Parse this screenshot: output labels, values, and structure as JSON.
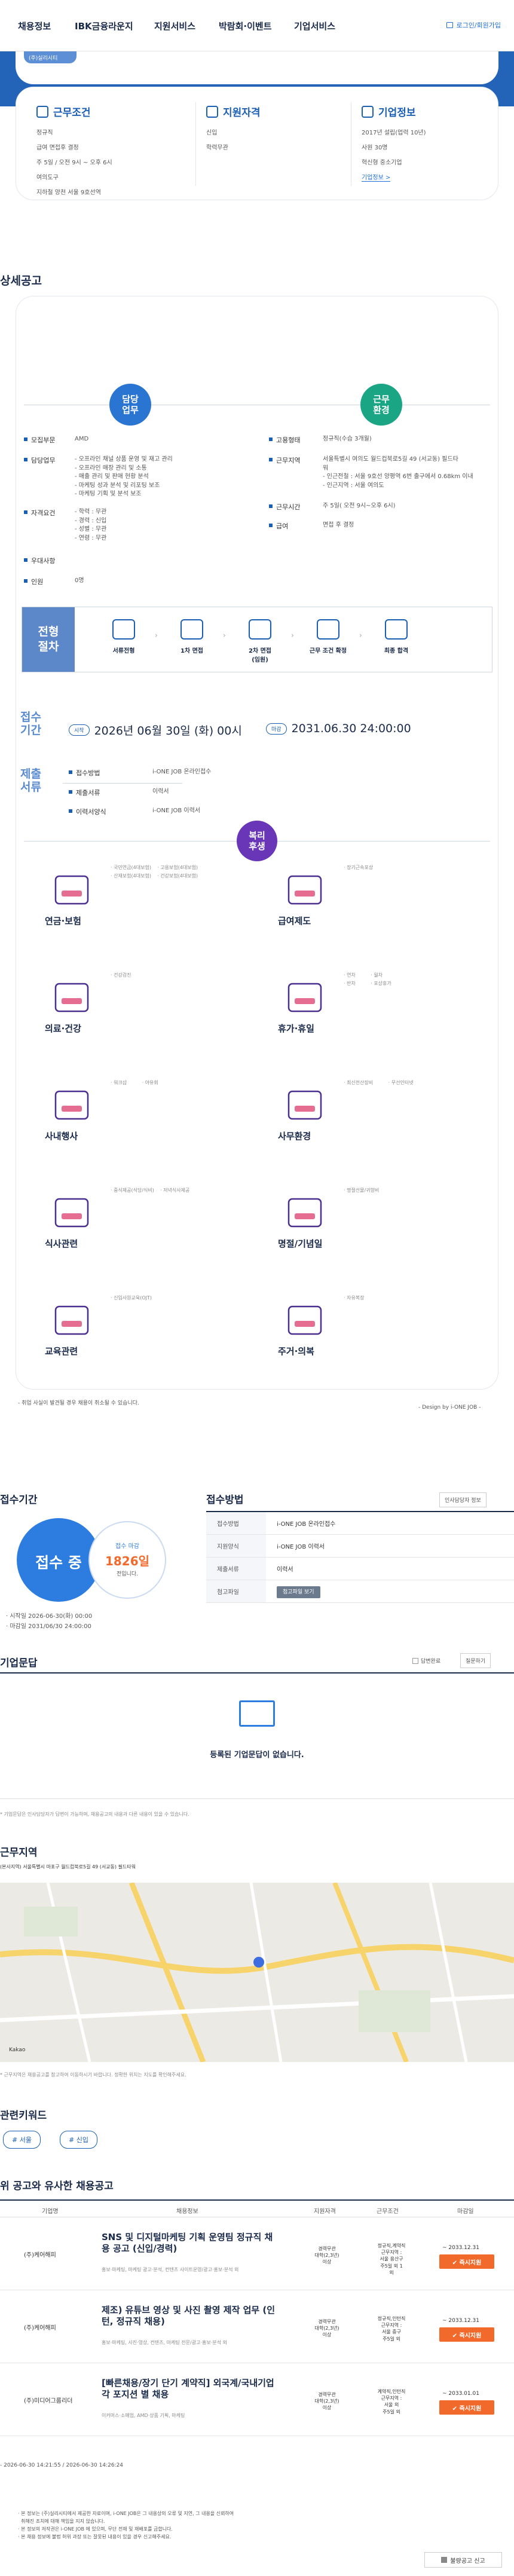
{
  "nav": {
    "items": [
      "채용정보",
      "IBK금융라운지",
      "지원서비스",
      "박람회·이벤트",
      "기업서비스"
    ],
    "login": "로그인/회원가입"
  },
  "band": {
    "tag": "(주)실리시티"
  },
  "summary": {
    "cols": [
      {
        "title": "근무조건",
        "lines": [
          "정규직",
          "급여 면접후 결정",
          "주 5일 / 오전 9시 ~ 오후 6시",
          "여의도구",
          "지하철 양천 서울 9호선역"
        ]
      },
      {
        "title": "지원자격",
        "lines": [
          "신입",
          "학력무관"
        ]
      },
      {
        "title": "기업정보",
        "lines": [
          "2017년 설립(업력 10년)",
          "사원 30명",
          "혁신형 중소기업"
        ],
        "link": "기업정보 >"
      }
    ]
  },
  "detail": {
    "title": "상세공고",
    "duty_circle": "담당\n업무",
    "env_circle": "근무\n환경",
    "left": [
      {
        "k": "모집부문",
        "v": "AMD"
      },
      {
        "k": "담당업무",
        "v": "- 오프라인 채널 상품 운영 및 재고 관리\n- 오프라인 매장 관리 및 소통\n- 매출 관리 및 판매 현황 분석\n- 마케팅 성과 분석 및 리포팅 보조\n- 마케팅 기획 및 분석 보조"
      },
      {
        "k": "자격요건",
        "v": "- 학력 : 무관\n- 경력 : 신입\n- 성별 : 무관\n- 연령 : 무관"
      },
      {
        "k": "우대사항",
        "v": ""
      },
      {
        "k": "인원",
        "v": "0명"
      }
    ],
    "right": [
      {
        "k": "고용형태",
        "v": "정규직(수습 3개월)"
      },
      {
        "k": "근무지역",
        "v": "서울특별시 여의도 월드컵북로5길 49 (서교동) 필드타\n워\n- 인근전철 : 서울 9호선 양평역 6번 출구에서 0.68km 이내\n- 인근지역 : 서울 여의도"
      },
      {
        "k": "근무시간",
        "v": "주 5일( 오전 9시~오후 6시)"
      },
      {
        "k": "급여",
        "v": "면접 후 결정"
      }
    ],
    "steps_label": "전형\n절차",
    "steps": [
      "서류전형",
      "1차 면접",
      "2차 면접\n(임원)",
      "근무 조건 확정",
      "최종 합격"
    ],
    "period_label": "접수\n기간",
    "start_pill": "시작",
    "start": "2026년 06월 30일 (화) 00시",
    "end_pill": "마감",
    "end": "2031.06.30 24:00:00",
    "docs_label": "제출\n서류",
    "docs": [
      {
        "k": "접수방법",
        "v": "i-ONE JOB 온라인접수"
      },
      {
        "k": "제출서류",
        "v": "이력서"
      },
      {
        "k": "이력서양식",
        "v": "i-ONE JOB 이력서"
      }
    ],
    "welfare_circle": "복리\n후생",
    "welfare": [
      {
        "label": "연금·보험",
        "items": "· 국민연금(4대보험)    · 고용보험(4대보험)\n· 산재보험(4대보험)    · 건강보험(4대보험)",
        "icon": "glasses-icon"
      },
      {
        "label": "급여제도",
        "items": "· 장기근속포상",
        "icon": "card-icon"
      },
      {
        "label": "의료·건강",
        "items": "· 건강검진",
        "icon": "heart-icon"
      },
      {
        "label": "휴가·휴일",
        "items": "· 연차          · 월차\n· 반차          · 포상휴가",
        "icon": "calendar-icon"
      },
      {
        "label": "사내행사",
        "items": "· 워크샵          · 야유회",
        "icon": "mic-icon"
      },
      {
        "label": "사무환경",
        "items": "· 최신전산장비          · 무선인터넷",
        "icon": "monitor-icon"
      },
      {
        "label": "식사관련",
        "items": "· 중식제공(식당/식비)    · 저녁식사제공",
        "icon": "bowl-icon"
      },
      {
        "label": "명절/기념일",
        "items": "· 명절선물/귀향비",
        "icon": "gift-icon"
      },
      {
        "label": "교육관련",
        "items": "· 신입사원교육(OJT)",
        "icon": "book-icon"
      },
      {
        "label": "주거·의복",
        "items": "· 자유복장",
        "icon": "shirt-icon"
      }
    ],
    "note": "- 취업 사실이 발견될 경우 채용이 취소될 수 있습니다.",
    "design_by": "- Design by i-ONE JOB -"
  },
  "apply": {
    "period_title": "접수기간",
    "status": "접수 중",
    "dday_label": "접수 마감",
    "dday": "1826일",
    "dday_suffix": "전입니다.",
    "start": "· 시작일 2026-06-30(화) 00:00",
    "end": "· 마감일 2031/06/30 24:00:00",
    "method_title": "접수방법",
    "resume_btn": "인사담당자 정보",
    "rows": [
      {
        "k": "접수방법",
        "v": "i-ONE JOB 온라인접수"
      },
      {
        "k": "지원양식",
        "v": "i-ONE JOB 이력서"
      },
      {
        "k": "제출서류",
        "v": "이력서"
      },
      {
        "k": "첨고파일",
        "v": "첨고파일 보기"
      }
    ]
  },
  "qna": {
    "title": "기업문답",
    "check": "답변완료",
    "write_btn": "질문하기",
    "empty": "등록된 기업문답이 없습니다.",
    "note": "* 기업문답은 인사담당자가 답변이 가능하며, 채용공고의 내용과 다른 내용이 있을 수 있습니다."
  },
  "location": {
    "title": "근무지역",
    "address": "(본사지역) 서울특별시 마포구 월드컵북로5길 49 (서교동) 필드타워",
    "note": "* 근무지역은 채용공고를 참고하여 이동하시기 바랍니다. 정확한 위치는 지도를 확인해주세요.",
    "scale": "Kakao"
  },
  "keywords": {
    "title": "관련키워드",
    "items": [
      "# 서울",
      "# 신입"
    ]
  },
  "similar": {
    "title": "위 공고와 유사한 채용공고",
    "head": [
      "기업명",
      "채용정보",
      "지원자격",
      "근무조건",
      "마감일"
    ],
    "rows": [
      {
        "co": "(주)케어해피",
        "title": "SNS 및 디지털마케팅 기획 운영팀 정규직 채용 공고 (신입/경력)",
        "sub": "홍보·마케팅, 마케팅 광고·분석, 컨텐츠 사이트운영/광고·홍보·분석 외",
        "c3": "경력무관\n대학(2,3년)\n이상",
        "c4": "정규직,계약직\n근무지역 :\n서울 용산구\n주5일 외 1\n외",
        "dl": "~ 2033.12.31",
        "apply": "✔ 즉시지원"
      },
      {
        "co": "(주)케어해피",
        "title": "제조) 유튜브 영상 및 사진 촬영 제작 업무 (인턴, 정규직 채용)",
        "sub": "홍보·마케팅, 사진·영상, 컨텐츠, 마케팅 전문/광고·홍보·분석 외",
        "c3": "경력무관\n대학(2,3년)\n이상",
        "c4": "정규직,인턴직\n근무지역 :\n서울 중구\n주5일 외",
        "dl": "~ 2033.12.31",
        "apply": "✔ 즉시지원"
      },
      {
        "co": "(주)미디어그룹리더",
        "title": "[빠른채용/장기 단기 계약직] 외국계/국내기업 각 포지션 별 채용",
        "sub": "이커머스·소매업, AMD·상품 기획, 마케팅",
        "c3": "경력무관\n대학(2,3년)\n이상",
        "c4": "계약직,인턴직\n근무지역 :\n서울 외\n주5일 외",
        "dl": "~ 2033.01.01",
        "apply": "✔ 즉시지원"
      }
    ]
  },
  "footer": {
    "dates": "- 2026-06-30 14:21:55 / 2026-06-30 14:26:24",
    "notes": [
      "· 본 정보는 (주)실리시티에서 제공한 자료이며, i-ONE JOB은 그 내용상의 오류 및 지연, 그 내용을 신뢰하여",
      "  취해진 조치에 대해 책임을 지지 않습니다.",
      "· 본 정보의 저작권은 i-ONE JOB 에 있으며, 무단 전재 및 재배포를 금합니다.",
      "· 본 채용 정보에 불법 허위 과장 또는 잘못된 내용이 있을 경우 신고해주세요."
    ],
    "report_btn": "불량공고 신고"
  }
}
